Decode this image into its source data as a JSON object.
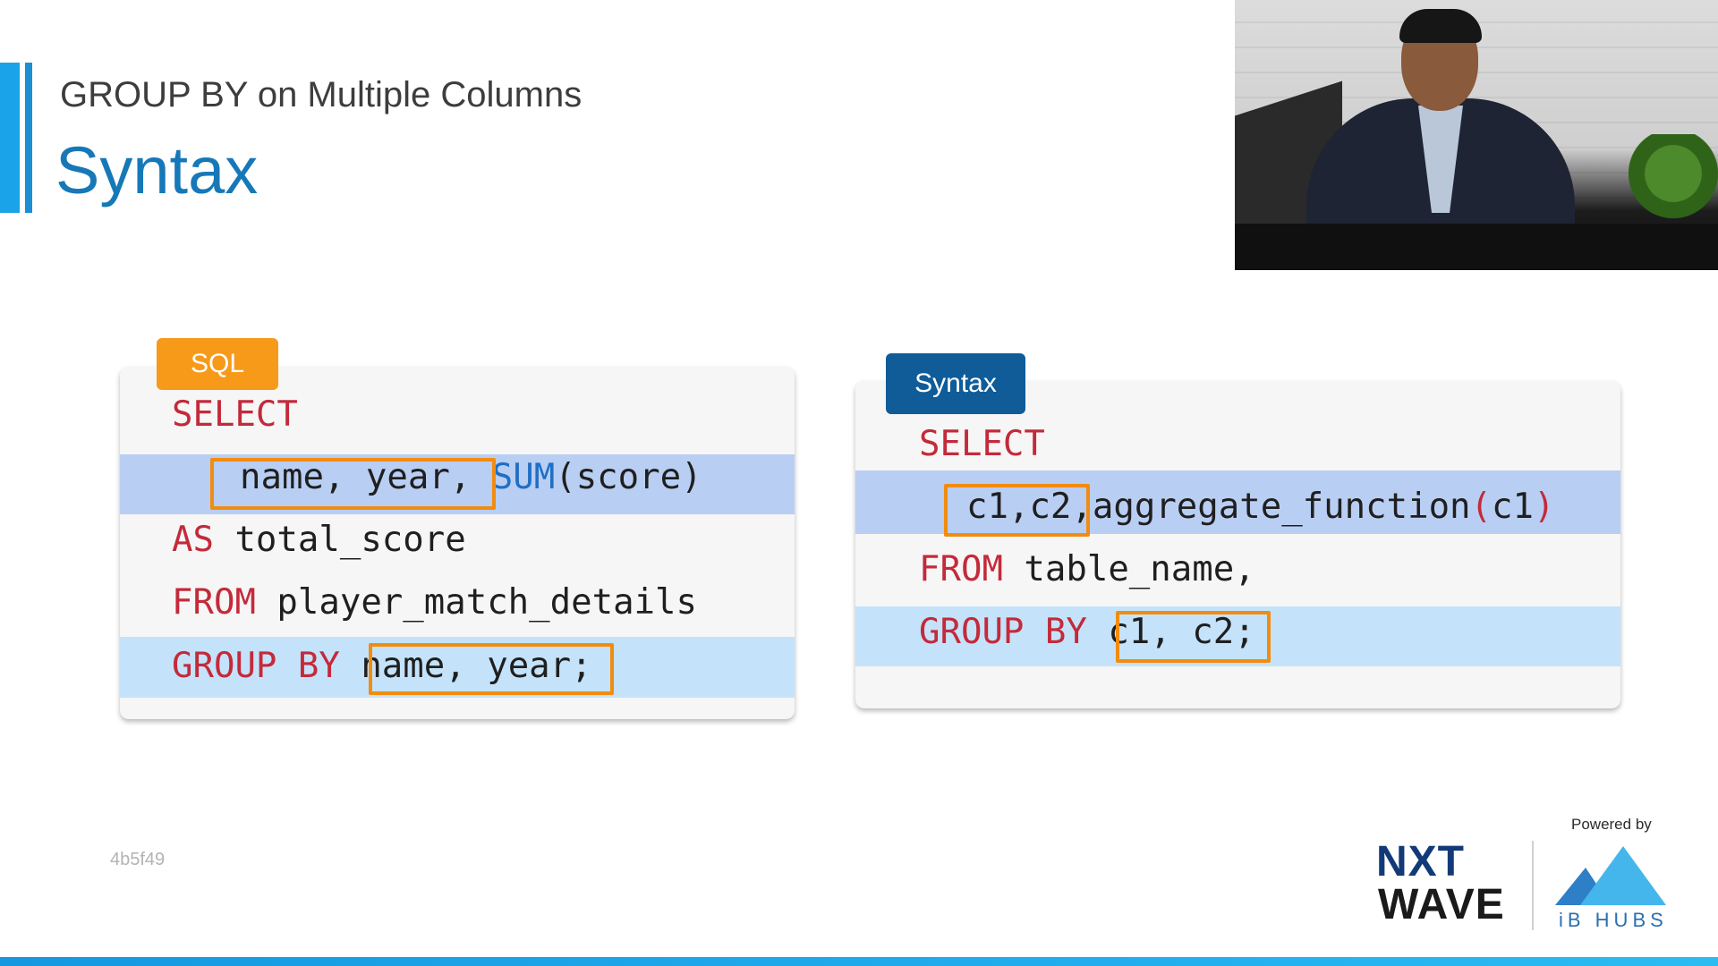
{
  "slide": {
    "subtitle": "GROUP BY on Multiple Columns",
    "title": "Syntax"
  },
  "left_panel": {
    "badge": "SQL",
    "lines": {
      "l1_kw": "SELECT",
      "l2_sel": "name, year,",
      "l2_fn": "SUM",
      "l2_rest": "(score)",
      "l3_kw": "AS",
      "l3_rest": " total_score",
      "l4_kw": "FROM",
      "l4_rest": " player_match_details",
      "l5_kw": "GROUP BY",
      "l5_cols": "name, year",
      "l5_end": ";"
    }
  },
  "right_panel": {
    "badge": "Syntax",
    "lines": {
      "l1_kw": "SELECT",
      "l2_cols": "c1,c2",
      "l2_fn": ",aggregate_function",
      "l2_open": "(",
      "l2_arg": "c1",
      "l2_close": ")",
      "l3_kw": "FROM",
      "l3_rest": " table_name,",
      "l4_kw": "GROUP BY",
      "l4_cols": "c1, c2",
      "l4_end": ";"
    }
  },
  "watermark": "4b5f49",
  "branding": {
    "powered_by": "Powered by",
    "logo_line1": "NXT",
    "logo_line2": "WAVE",
    "partner_name": "iB HUBS"
  },
  "colors": {
    "accent_blue": "#1a8fd6",
    "title_blue": "#1778b8",
    "sql_badge": "#f79a1a",
    "syntax_badge": "#0f5c99",
    "keyword_red": "#c32a3a",
    "highlight_box_orange": "#f28c10"
  }
}
